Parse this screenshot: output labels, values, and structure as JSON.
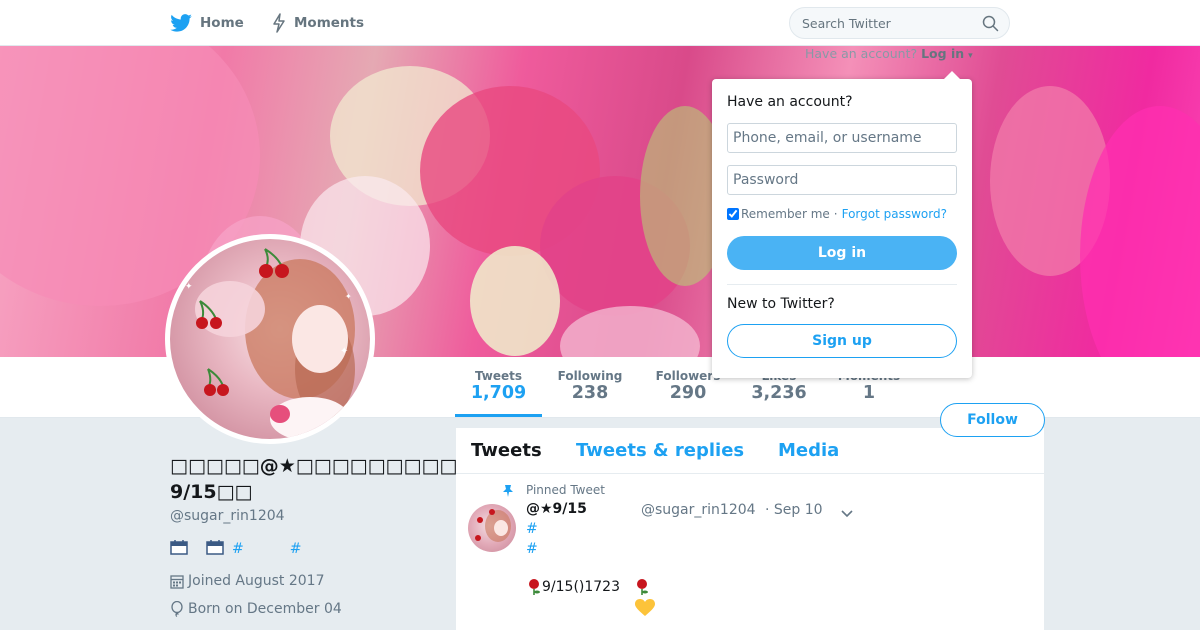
{
  "colors": {
    "accent": "#1da1f2",
    "text": "#14171a",
    "muted": "#657786",
    "background": "#e6ecf0"
  },
  "nav": {
    "home_label": "Home",
    "moments_label": "Moments",
    "search_placeholder": "Search Twitter"
  },
  "login_prompt": {
    "text": "Have an account?",
    "link": "Log in"
  },
  "profile": {
    "name": "□□□□□@★□□□□□□□□□□□□ 9/15□□",
    "handle": "@sugar_rin1204",
    "bio_links": [
      "#",
      "#"
    ],
    "joined": "Joined August 2017",
    "born": "Born on December 04"
  },
  "stats": [
    {
      "label": "Tweets",
      "value": "1,709"
    },
    {
      "label": "Following",
      "value": "238"
    },
    {
      "label": "Followers",
      "value": "290"
    },
    {
      "label": "Likes",
      "value": "3,236"
    },
    {
      "label": "Moments",
      "value": "1"
    }
  ],
  "follow_label": "Follow",
  "timeline": {
    "tabs": [
      "Tweets",
      "Tweets & replies",
      "Media"
    ],
    "pinned_label": "Pinned Tweet",
    "tweet": {
      "name": "@★9/15",
      "handle": "@sugar_rin1204",
      "date": "· Sep 10",
      "lines": [
        "#",
        "#"
      ],
      "text": "9/15()1723"
    }
  },
  "login_dropdown": {
    "title": "Have an account?",
    "username_placeholder": "Phone, email, or username",
    "password_placeholder": "Password",
    "remember_label": "Remember me",
    "separator": "·",
    "forgot_label": "Forgot password?",
    "login_button": "Log in",
    "new_label": "New to Twitter?",
    "signup_button": "Sign up"
  }
}
